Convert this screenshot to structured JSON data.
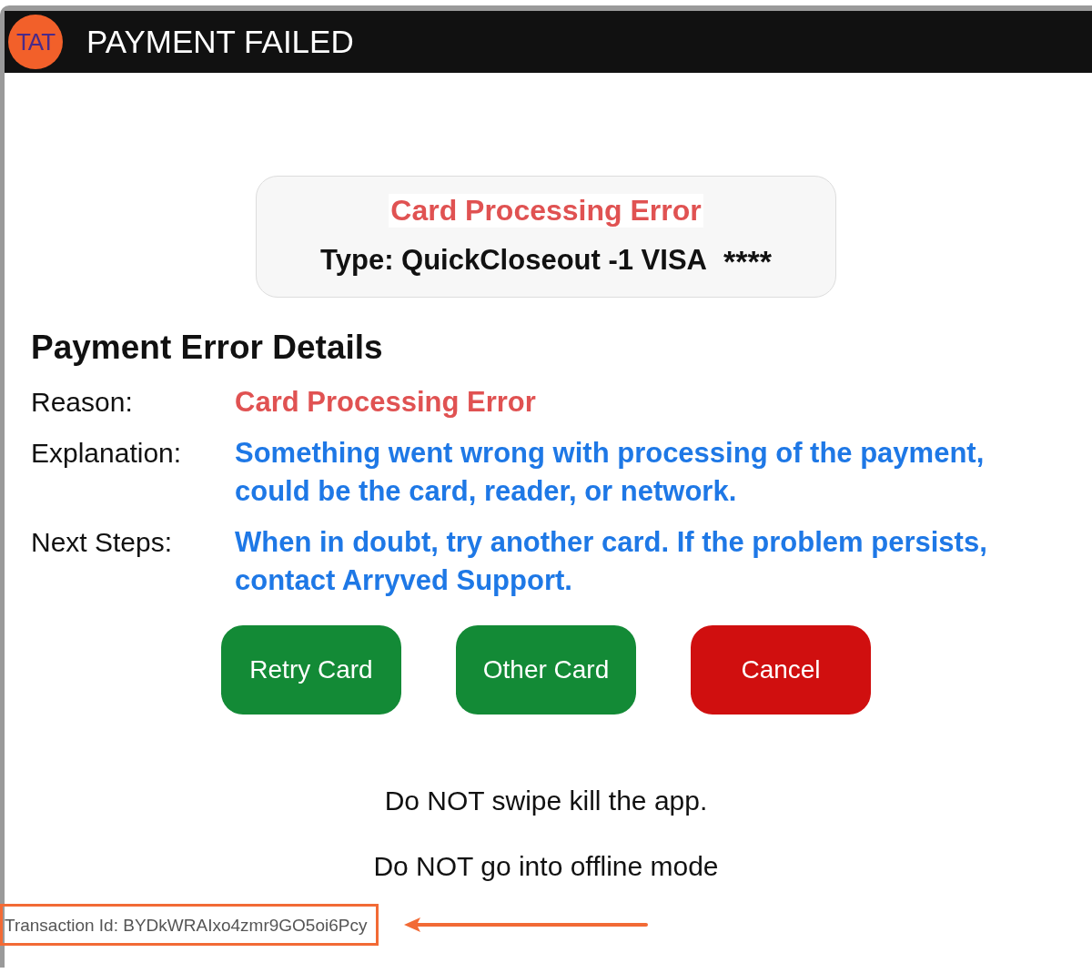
{
  "header": {
    "logo": "TAT",
    "title": "PAYMENT FAILED"
  },
  "summary": {
    "title": "Card Processing Error",
    "type": "Type: QuickCloseout -1 VISA",
    "masked": "****"
  },
  "details": {
    "heading": "Payment Error Details",
    "rows": [
      {
        "label": "Reason:",
        "value": "Card Processing Error",
        "kind": "error"
      },
      {
        "label": "Explanation:",
        "value": "Something went wrong with processing of the payment, could be the card, reader, or network.",
        "kind": "info"
      },
      {
        "label": "Next Steps:",
        "value": "When in doubt, try another card. If the problem persists, contact Arryved Support.",
        "kind": "info"
      }
    ]
  },
  "buttons": [
    {
      "label": "Retry Card",
      "kind": "confirm"
    },
    {
      "label": "Other Card",
      "kind": "confirm"
    },
    {
      "label": "Cancel",
      "kind": "cancel"
    }
  ],
  "warnings": [
    "Do NOT swipe kill the app.",
    "Do NOT go into offline mode"
  ],
  "transaction_id": "Transaction Id: BYDkWRAIxo4zmr9GO5oi6Pcy"
}
